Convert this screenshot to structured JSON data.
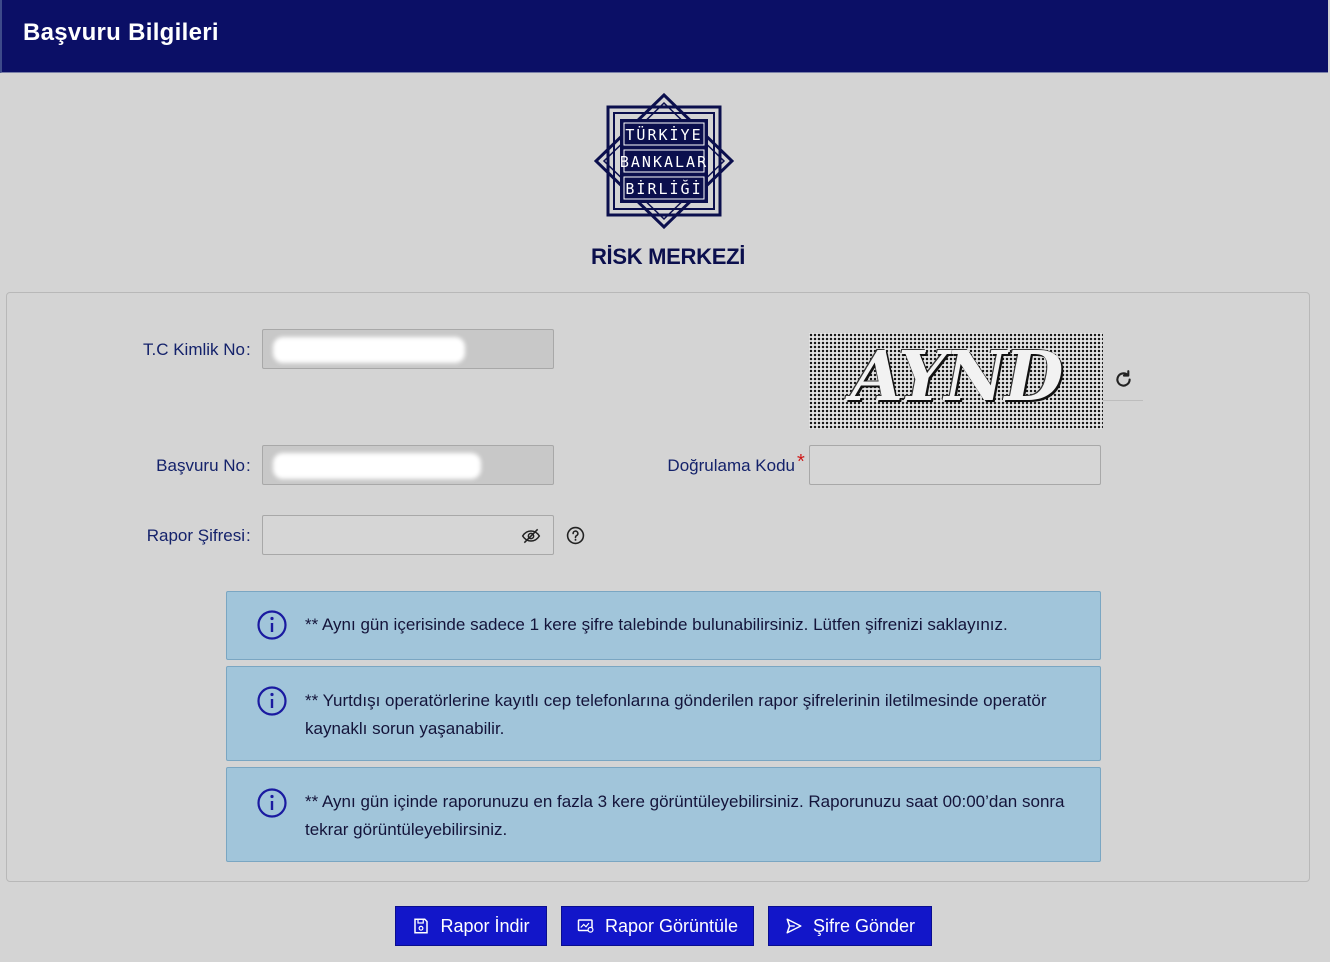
{
  "header": {
    "title": "Başvuru Bilgileri"
  },
  "brand": {
    "name": "RİSK MERKEZİ"
  },
  "form": {
    "tc_label": "T.C Kimlik No",
    "basvuru_label": "Başvuru No",
    "rapor_sifresi_label": "Rapor Şifresi",
    "dogrulama_label": "Doğrulama Kodu",
    "required_mark": "*",
    "colon": ":",
    "rapor_sifresi_value": "",
    "dogrulama_value": ""
  },
  "captcha": {
    "text": "AYND"
  },
  "info": [
    {
      "text": "** Aynı gün içerisinde sadece 1 kere şifre talebinde bulunabilirsiniz. Lütfen şifrenizi saklayınız."
    },
    {
      "text": "** Yurtdışı operatörlerine kayıtlı cep telefonlarına gönderilen rapor şifrelerinin iletilmesinde operatör kaynaklı sorun yaşanabilir."
    },
    {
      "text": "** Aynı gün içinde raporunuzu en fazla 3 kere görüntüleyebilirsiniz. Raporunuzu saat 00:00’dan sonra tekrar görüntüleyebilirsiniz."
    }
  ],
  "buttons": {
    "rapor_indir": "Rapor İndir",
    "rapor_goruntule": "Rapor Görüntüle",
    "sifre_gonder": "Şifre Gönder"
  },
  "colors": {
    "header_bg": "#0b0f66",
    "button_bg": "#1216c9",
    "info_bg": "#a1c5da",
    "required": "#d01818"
  }
}
